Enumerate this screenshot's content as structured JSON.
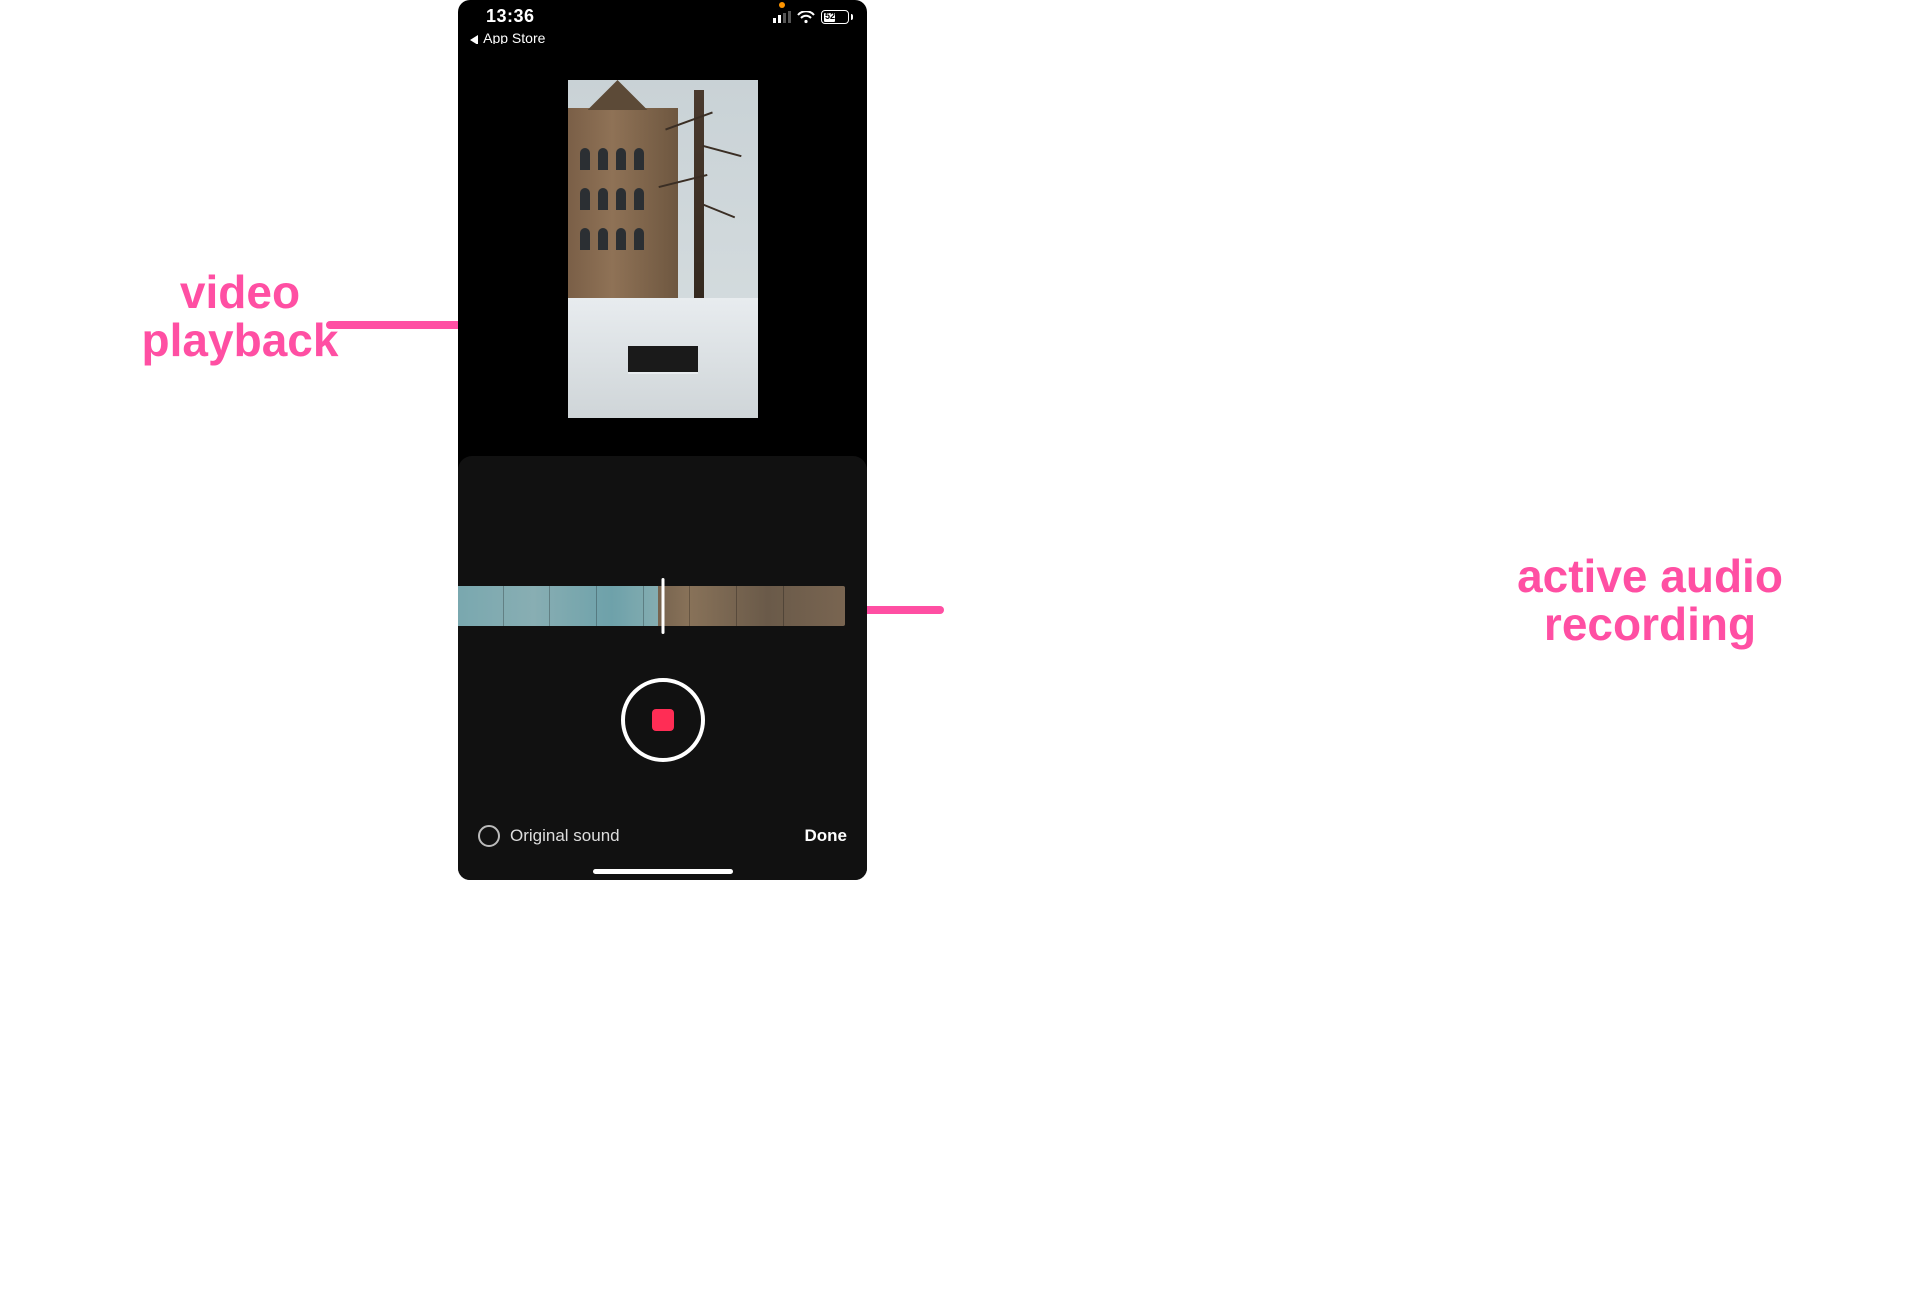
{
  "statusbar": {
    "time": "13:36",
    "back_label": "App Store",
    "battery_percent": "52"
  },
  "timeline": {
    "recorded_fraction": 0.52
  },
  "footer": {
    "original_sound_label": "Original sound",
    "done_label": "Done"
  },
  "annotations": {
    "left": "video playback",
    "right": "active audio recording"
  },
  "icons": {
    "back": "back-triangle-icon",
    "signal": "cell-signal-icon",
    "wifi": "wifi-icon",
    "battery": "battery-icon",
    "record": "stop-recording-icon",
    "radio": "radio-unchecked-icon"
  }
}
